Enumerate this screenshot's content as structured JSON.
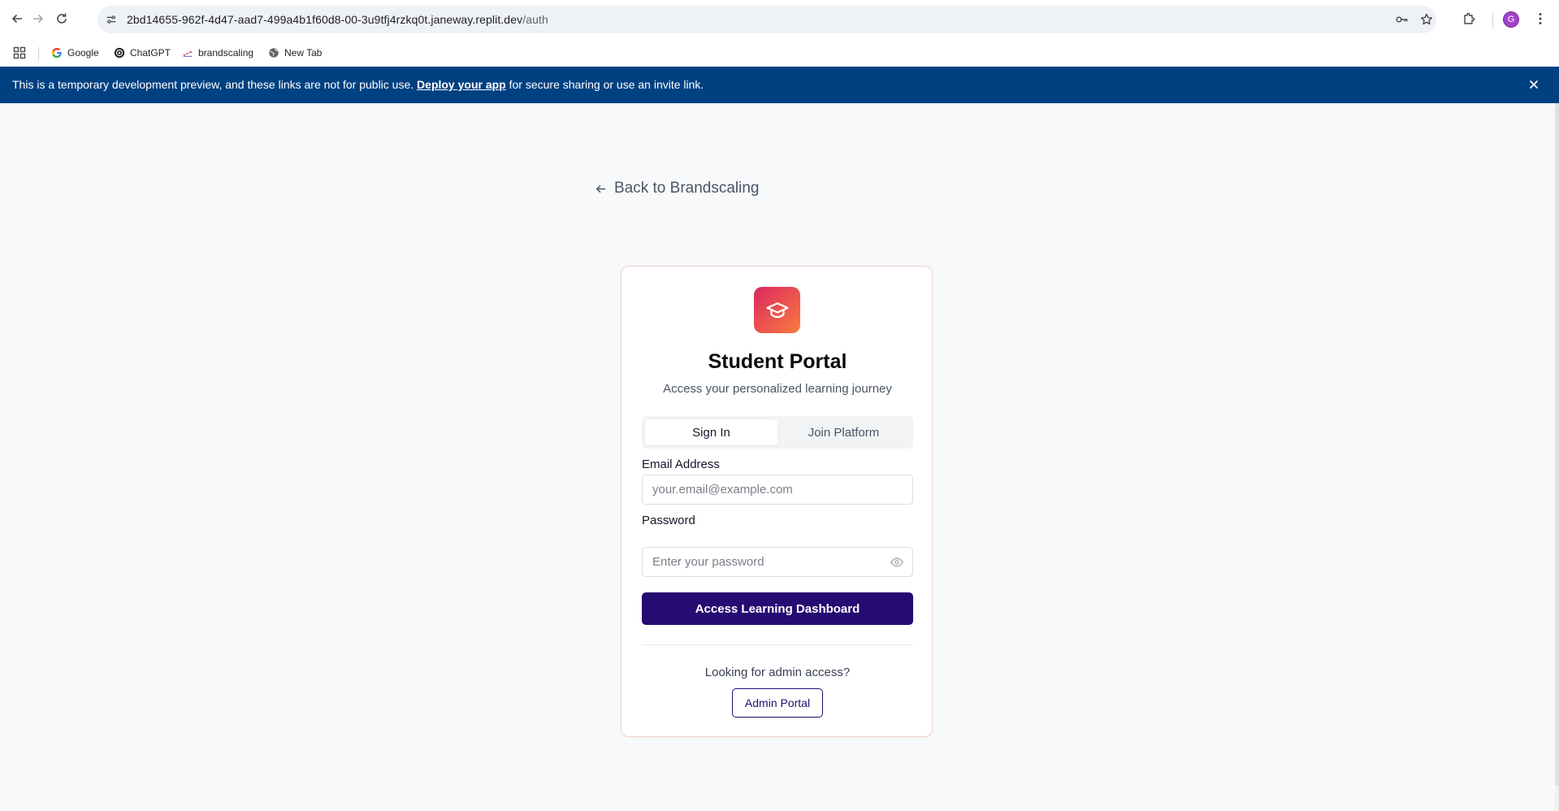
{
  "browser": {
    "url_host": "2bd14655-962f-4d47-aad7-499a4b1f60d8-00-3u9tfj4rzkq0t.janeway.replit.dev",
    "url_path": "/auth",
    "profile_initial": "G",
    "bookmarks": [
      {
        "label": "Google",
        "icon": "google-icon"
      },
      {
        "label": "ChatGPT",
        "icon": "chatgpt-icon"
      },
      {
        "label": "brandscaling",
        "icon": "brandscaling-icon"
      },
      {
        "label": "New Tab",
        "icon": "globe-icon"
      }
    ]
  },
  "banner": {
    "prefix": "This is a temporary development preview, and these links are not for public use.",
    "link": "Deploy your app",
    "suffix": "for secure sharing or use an invite link.",
    "color": "#004182"
  },
  "page": {
    "back_link": "Back to Brandscaling"
  },
  "card": {
    "icon": "graduation-cap-icon",
    "title": "Student Portal",
    "subtitle": "Access your personalized learning journey",
    "tabs": [
      {
        "label": "Sign In",
        "active": true
      },
      {
        "label": "Join Platform",
        "active": false
      }
    ],
    "email_label": "Email Address",
    "email_placeholder": "your.email@example.com",
    "password_label": "Password",
    "password_placeholder": "Enter your password",
    "submit_label": "Access Learning Dashboard",
    "admin_question": "Looking for admin access?",
    "admin_button": "Admin Portal",
    "accent_color": "#260b72",
    "logo_gradient": [
      "#db2760",
      "#f97b3d"
    ]
  }
}
